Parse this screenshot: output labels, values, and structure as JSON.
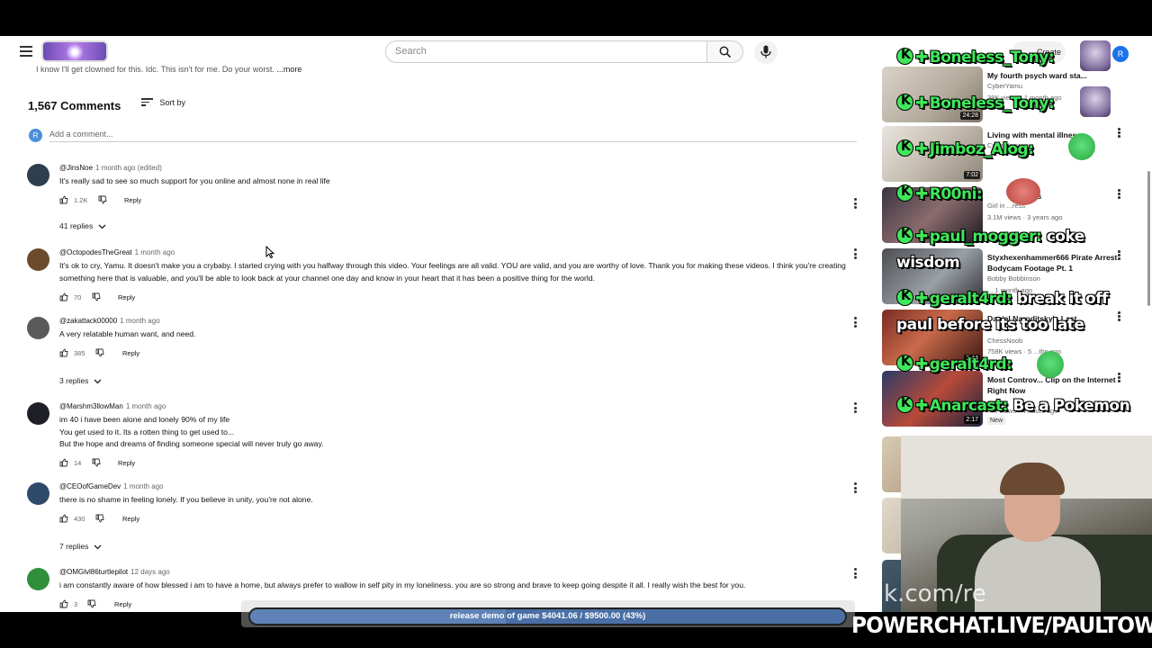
{
  "masthead": {
    "search_placeholder": "Search",
    "create_label": "Create",
    "user_initial": "R"
  },
  "description": {
    "text": "I know I'll get clowned for this. Idc. This isn't for me. Do your worst.",
    "more": "...more"
  },
  "comments_header": {
    "count": "1,567 Comments",
    "sort_label": "Sort by",
    "add_avatar": "R",
    "add_placeholder": "Add a comment..."
  },
  "comments": [
    {
      "author": "@JinsNoe",
      "ago": "1 month ago (edited)",
      "body": "It's really sad to see so much support for you online and almost none in real life",
      "likes": "1.2K",
      "reply": "Reply",
      "replies": "41 replies",
      "avatar_color": "#2c3e50"
    },
    {
      "author": "@OctopodesTheGreat",
      "ago": "1 month ago",
      "body": "It's ok to cry, Yamu. It doesn't make you a crybaby. I started crying with you halfway through this video. Your feelings are all valid. YOU are valid, and you are worthy of love. Thank you for making these videos. I think you're creating something here that is valuable, and you'll be able to look back at your channel one day and know in your heart that it has been a positive thing for the world.",
      "likes": "70",
      "reply": "Reply",
      "replies": "",
      "avatar_color": "#6b4a2e"
    },
    {
      "author": "@zakattack00000",
      "ago": "1 month ago",
      "body": "A very relatable human want, and need.",
      "likes": "385",
      "reply": "Reply",
      "replies": "3 replies",
      "avatar_color": "#5a5a5a"
    },
    {
      "author": "@Marshm3llowMan",
      "ago": "1 month ago",
      "body_lines": [
        "im 40 i have been alone and lonely 90% of my life",
        "You get used to it. Its a rotten thing to get used to...",
        "But the hope and dreams of finding someone special will never truly go away."
      ],
      "likes": "14",
      "reply": "Reply",
      "replies": "",
      "avatar_color": "#1f1f28"
    },
    {
      "author": "@CEOofGameDev",
      "ago": "1 month ago",
      "body": "there is no shame in feeling lonely. If you believe in unity, you're not alone.",
      "likes": "430",
      "reply": "Reply",
      "replies": "7 replies",
      "avatar_color": "#2e4a6b"
    },
    {
      "author": "@OMGlvl86turtlepilot",
      "ago": "12 days ago",
      "body": "i am constantly aware of how blessed i am to have a home, but always prefer to wallow in self pity in my loneliness. you are so strong and brave to keep going despite it all. I really wish the best for you.",
      "likes": "3",
      "reply": "Reply",
      "replies": "",
      "avatar_color": "#2f8f3a"
    }
  ],
  "sidebar": [
    {
      "title": "My fourth psych ward sta...",
      "channel": "CyberYamu",
      "meta": "38K views · 1 month ago",
      "duration": "24:28"
    },
    {
      "title": "Living with mental illness",
      "channel": "CyberYamu",
      "meta": "",
      "duration": "7:02"
    },
    {
      "title": "...ends",
      "channel": "Girl in ...ress",
      "meta": "3.1M views · 3 years ago",
      "duration": ""
    },
    {
      "title": "Styxhexenhammer666 Pirate Arrest Bodycam Footage Pt. 1",
      "channel": "Bobby Bobbinson",
      "meta": "... 1 month ago",
      "duration": ""
    },
    {
      "title": "Daniel Naroditsky's Last",
      "channel": "ChessNoob",
      "meta": "758K views · 5 ...ths ago",
      "duration": "2:44"
    },
    {
      "title": "Most Controv... Clip on the Internet Right Now",
      "channel": "",
      "meta": "...K views · 4 hours ago",
      "duration": "2:17",
      "badge": "New"
    }
  ],
  "chat": [
    {
      "user": "Boneless_Tony:",
      "text": ""
    },
    {
      "user": "Boneless_Tony:",
      "text": ""
    },
    {
      "user": "Jimboz_Alog:",
      "text": ""
    },
    {
      "user": "R00ni:",
      "text": ""
    },
    {
      "user": "paul_mogger:",
      "text": "coke"
    },
    {
      "user": "",
      "text": "wisdom"
    },
    {
      "user": "geralt4rd:",
      "text": "break it off"
    },
    {
      "user": "",
      "text": "paul before its too late"
    },
    {
      "user": "geralt4rd:",
      "text": ""
    },
    {
      "user": "Anarcast:",
      "text": "Be a Pokemon"
    }
  ],
  "donation": {
    "text": "release demo of game $4041.06 / $9500.00 (43%)",
    "progress": 0.43
  },
  "powerchat": "POWERCHAT.LIVE/PAULTOWN",
  "watermark": "k.com/re"
}
